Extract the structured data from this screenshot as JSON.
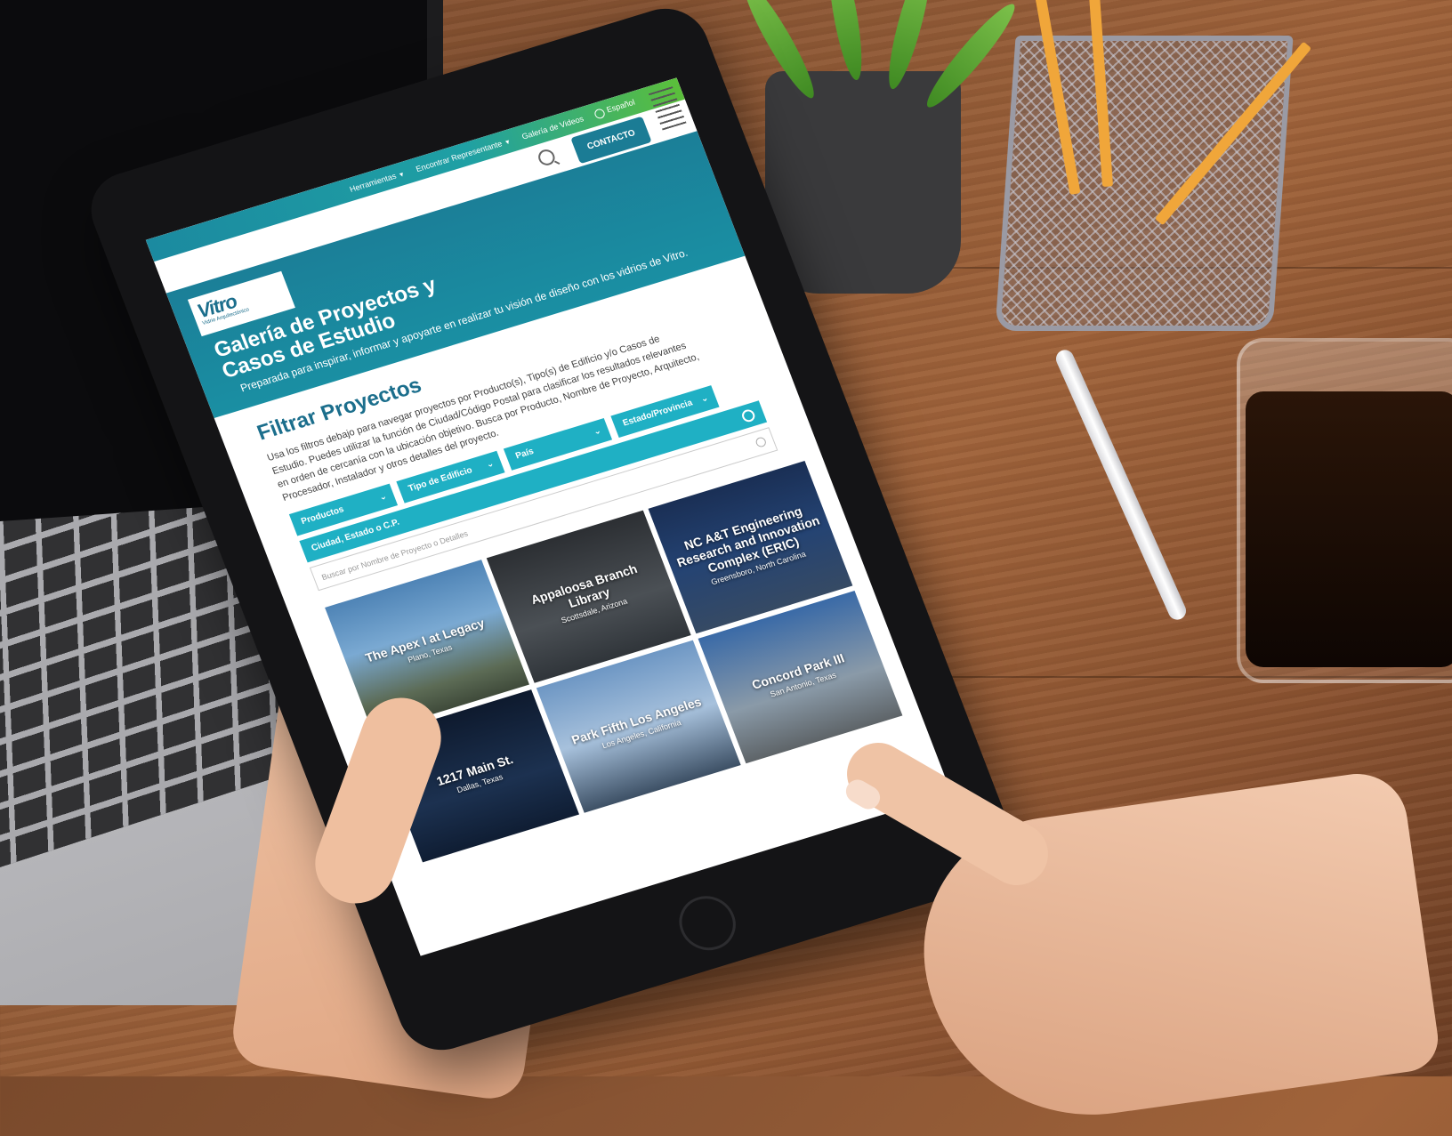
{
  "nav": {
    "utility_links": [
      {
        "label": "Herramientas",
        "has_menu": true
      },
      {
        "label": "Encontrar Representante",
        "has_menu": true
      },
      {
        "label": "Galería de Videos",
        "has_menu": false
      },
      {
        "label": "Español",
        "has_menu": false
      }
    ],
    "contact_label": "CONTACTO",
    "colors": {
      "teal": "#1b7f98",
      "green": "#5bbf3a",
      "accent": "#1fb0c4"
    }
  },
  "brand": {
    "logo_text": "Vitro",
    "logo_sub": "Vidrio Arquitectónico"
  },
  "hero": {
    "title": "Galería de Proyectos y Casos de Estudio",
    "subtitle": "Preparada para inspirar, informar y apoyarte en realizar tu visión de diseño con los vidrios de Vitro."
  },
  "filter": {
    "title": "Filtrar Proyectos",
    "description": "Usa los filtros debajo para navegar proyectos por Producto(s), Tipo(s) de Edificio y/o Casos de Estudio. Puedes utilizar la función de Ciudad/Código Postal para clasificar los resultados relevantes en orden de cercanía con la ubicación objetivo. Busca por Producto, Nombre de Proyecto, Arquitecto, Procesador, Instalador y otros detalles del proyecto.",
    "dropdowns": [
      "Productos",
      "Tipo de Edificio",
      "País",
      "Estado/Provincia"
    ],
    "city_placeholder": "Ciudad, Estado o C.P.",
    "search_placeholder": "Buscar por Nombre de Proyecto o Detalles"
  },
  "projects": [
    {
      "name": "The Apex I at Legacy",
      "location": "Plano, Texas"
    },
    {
      "name": "Appaloosa Branch Library",
      "location": "Scottsdale, Arizona"
    },
    {
      "name": "NC A&T Engineering Research and Innovation Complex (ERIC)",
      "location": "Greensboro, North Carolina"
    },
    {
      "name": "1217 Main St.",
      "location": "Dallas, Texas"
    },
    {
      "name": "Park Fifth Los Angeles",
      "location": "Los Angeles, California"
    },
    {
      "name": "Concord Park III",
      "location": "San Antonio, Texas"
    }
  ]
}
